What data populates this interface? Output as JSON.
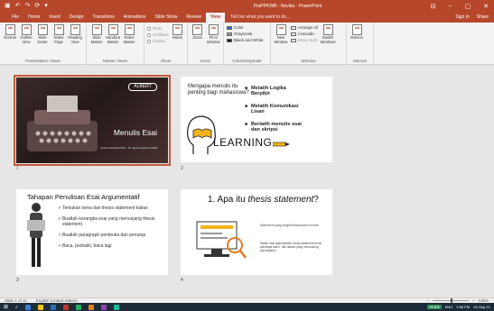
{
  "titlebar": {
    "qat": [
      "▣",
      "↶",
      "↷",
      "⟳",
      "▾"
    ],
    "title": "PraPPKWB - Nevika - PowerPoint",
    "controls": [
      "⊟",
      "–",
      "▢",
      "✕"
    ]
  },
  "tabs": {
    "items": [
      "File",
      "Home",
      "Insert",
      "Design",
      "Transitions",
      "Animations",
      "Slide Show",
      "Review",
      "View"
    ],
    "active_index": 8,
    "tell_me": "Tell me what you want to do...",
    "sign_in": "Sign in",
    "share": "Share"
  },
  "ribbon": {
    "groups": [
      {
        "label": "Presentation Views",
        "buttons": [
          "Normal",
          "Outline View",
          "Slide Sorter",
          "Notes Page",
          "Reading View"
        ]
      },
      {
        "label": "Master Views",
        "buttons": [
          "Slide Master",
          "Handout Master",
          "Notes Master"
        ]
      },
      {
        "label": "Show",
        "checks": [
          "Ruler",
          "Gridlines",
          "Guides"
        ],
        "buttons": [
          "Notes"
        ]
      },
      {
        "label": "Zoom",
        "buttons": [
          "Zoom",
          "Fit to Window"
        ]
      },
      {
        "label": "Color/Grayscale",
        "options": [
          "Color",
          "Grayscale",
          "Black and White"
        ]
      },
      {
        "label": "Window",
        "buttons": [
          "New Window"
        ],
        "options": [
          "Arrange All",
          "Cascade",
          "Move Split"
        ],
        "switch": "Switch Windows"
      },
      {
        "label": "Macros",
        "buttons": [
          "Macros"
        ]
      }
    ]
  },
  "slides": [
    {
      "number": "1",
      "title": "Menulis Esai",
      "logo": "ALBERT",
      "subtitle": "Lestina Setiadi (NIM) · Ari Jaya Angraeini (NIM)"
    },
    {
      "number": "2",
      "question": "Mengapa menulis itu penting bagi mahasiswa?",
      "bullets": [
        "Melatih Logika Berpikir",
        "Melatih Komunikasi Lisan",
        "Berlatih menulis esai dan skripsi"
      ],
      "banner": "LEARNING"
    },
    {
      "number": "3",
      "title": "Tahapan Penulisan Esai Argumentatif",
      "steps": [
        "Tentukan tema dan thesis statement kalian",
        "Buatlah kerangka esai yang menunjang thesis statement",
        "Buatlah paragraph pembuka dan penutup",
        "Baca, perbaiki, baca lagi"
      ]
    },
    {
      "number": "4",
      "title_plain": "1. Apa itu ",
      "title_italic": "thesis statement",
      "title_end": "?",
      "notes": [
        "Kalimat inti yang menjadi keseluruhan isi esai",
        "Dalam esai argumentatif, thesis statement berisi pendapat kamu, dan alasan yang mendukung pendapatmu"
      ]
    }
  ],
  "status": {
    "slide_info": "Slide 1 of 11",
    "language": "English (United States)",
    "zoom": "135%"
  },
  "taskbar": {
    "battery": "95.8%",
    "lang": "ENG",
    "time": "9:56 PM",
    "date": "24-Sep-21"
  },
  "colors": {
    "accent": "#b7472a",
    "selection": "#c45a3b",
    "taskbar": "#1c2b3a",
    "learning_pencil": "#f2b21b"
  }
}
